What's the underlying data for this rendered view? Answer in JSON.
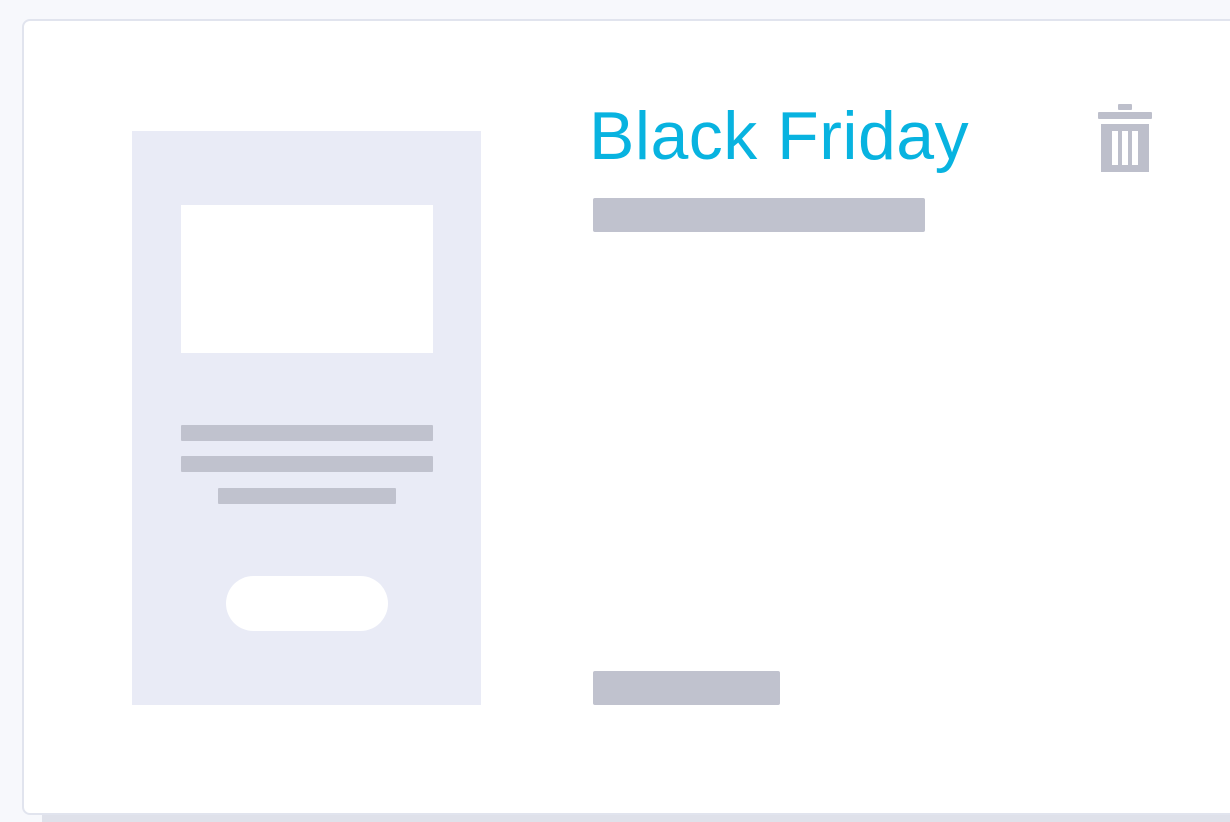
{
  "campaign": {
    "title": "Black Friday"
  },
  "colors": {
    "accent": "#08b3e0",
    "placeholder": "#c0c2ce",
    "thumbnail_background": "#e9ebf6",
    "icon": "#bdbfcb"
  },
  "icons": {
    "delete": "trash-icon"
  }
}
